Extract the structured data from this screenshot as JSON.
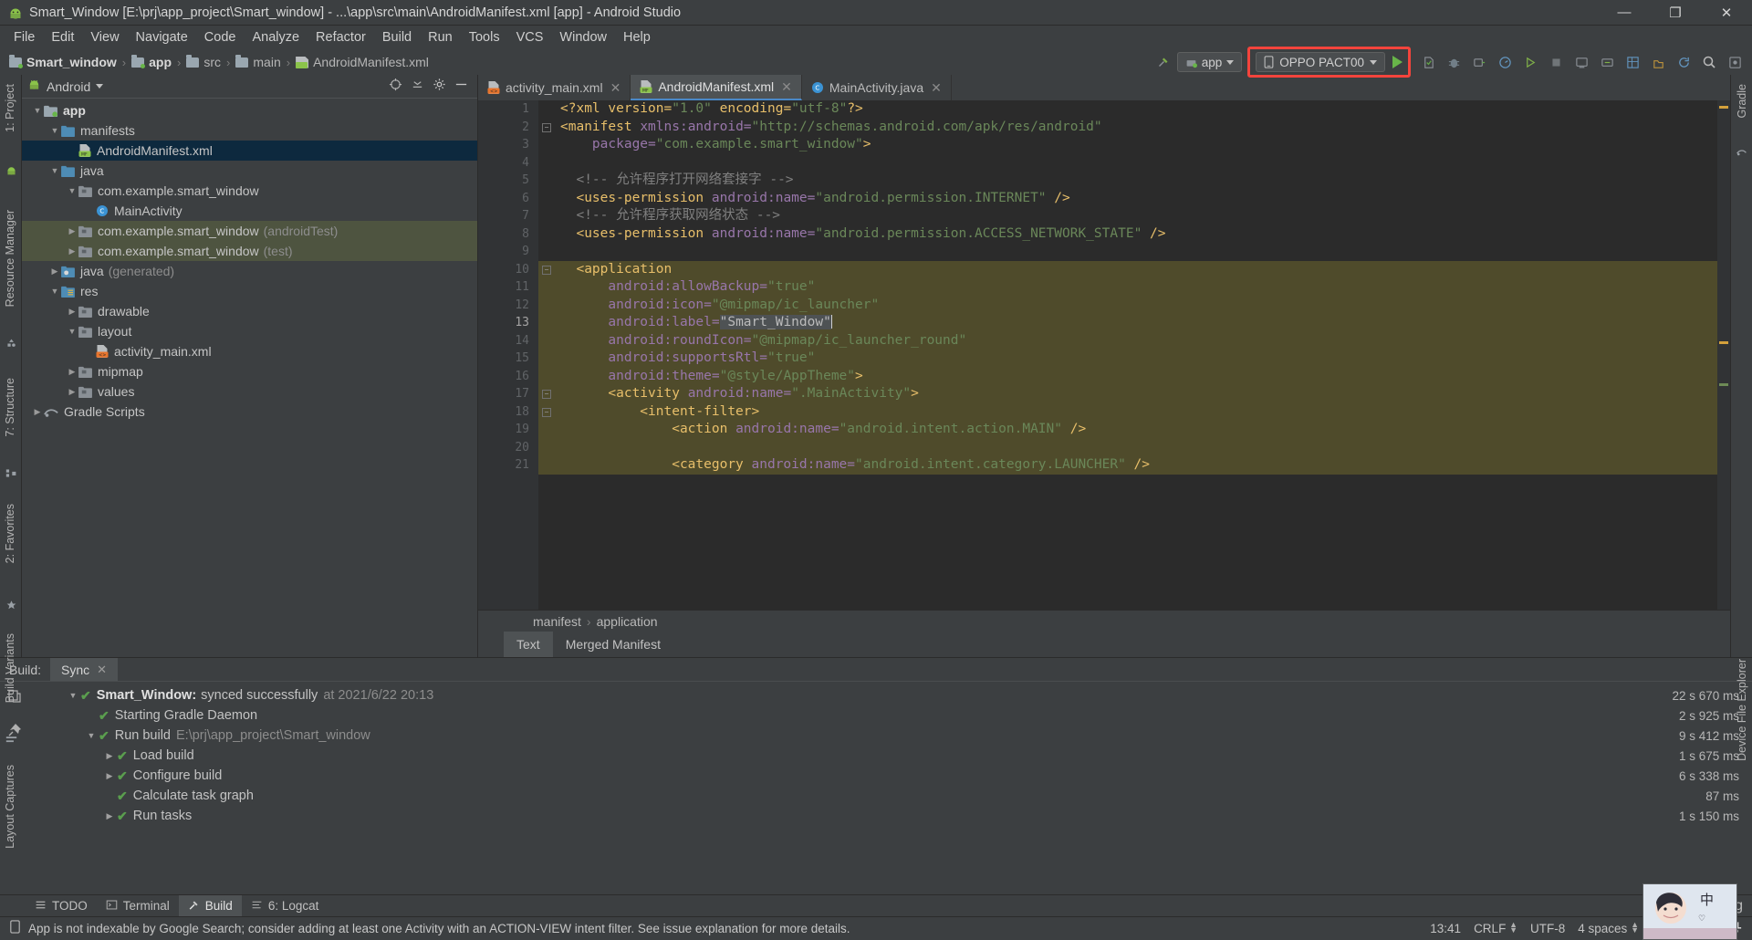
{
  "window": {
    "title": "Smart_Window [E:\\prj\\app_project\\Smart_window] - ...\\app\\src\\main\\AndroidManifest.xml [app] - Android Studio",
    "icon": "android-studio-icon",
    "minimize": "—",
    "maximize": "❐",
    "close": "✕"
  },
  "menu": {
    "items": [
      "File",
      "Edit",
      "View",
      "Navigate",
      "Code",
      "Analyze",
      "Refactor",
      "Build",
      "Run",
      "Tools",
      "VCS",
      "Window",
      "Help"
    ]
  },
  "breadcrumb": {
    "items": [
      "Smart_window",
      "app",
      "src",
      "main",
      "AndroidManifest.xml"
    ]
  },
  "toolbar": {
    "module_label": "app",
    "device_label": "OPPO PACT00",
    "run_tooltip": "Run",
    "icons": [
      "build-hammer-icon",
      "run-icon",
      "debug-icon",
      "attach-debugger-icon",
      "profiler-icon",
      "run-coverage-icon",
      "stop-icon",
      "avd-manager-icon",
      "sdk-manager-icon",
      "layout-inspector-icon",
      "device-file-explorer-icon",
      "sync-gradle-icon",
      "search-icon",
      "settings-icon"
    ]
  },
  "left_rail": {
    "items": [
      "1: Project",
      "Resource Manager",
      "7: Structure",
      "2: Favorites",
      "Build Variants",
      "Layout Captures"
    ]
  },
  "right_rail": {
    "items": [
      "Gradle",
      "Device File Explorer"
    ]
  },
  "project_panel": {
    "title": "Android",
    "tree": [
      {
        "depth": 0,
        "arrow": "down",
        "icon": "app-module-icon",
        "label": "app",
        "suffix": "",
        "bold": true,
        "state": "normal"
      },
      {
        "depth": 1,
        "arrow": "down",
        "icon": "folder-blue-icon",
        "label": "manifests",
        "suffix": "",
        "bold": false,
        "state": "normal"
      },
      {
        "depth": 2,
        "arrow": "none",
        "icon": "manifest-file-icon",
        "label": "AndroidManifest.xml",
        "suffix": "",
        "bold": false,
        "state": "selected"
      },
      {
        "depth": 1,
        "arrow": "down",
        "icon": "folder-blue-icon",
        "label": "java",
        "suffix": "",
        "bold": false,
        "state": "normal"
      },
      {
        "depth": 2,
        "arrow": "down",
        "icon": "package-icon",
        "label": "com.example.smart_window",
        "suffix": "",
        "bold": false,
        "state": "normal"
      },
      {
        "depth": 3,
        "arrow": "none",
        "icon": "java-class-icon",
        "label": "MainActivity",
        "suffix": "",
        "bold": false,
        "state": "normal"
      },
      {
        "depth": 2,
        "arrow": "right",
        "icon": "package-icon",
        "label": "com.example.smart_window",
        "suffix": "(androidTest)",
        "bold": false,
        "state": "test"
      },
      {
        "depth": 2,
        "arrow": "right",
        "icon": "package-icon",
        "label": "com.example.smart_window",
        "suffix": "(test)",
        "bold": false,
        "state": "test"
      },
      {
        "depth": 1,
        "arrow": "right",
        "icon": "folder-generated-icon",
        "label": "java",
        "suffix": "(generated)",
        "bold": false,
        "state": "normal"
      },
      {
        "depth": 1,
        "arrow": "down",
        "icon": "folder-res-icon",
        "label": "res",
        "suffix": "",
        "bold": false,
        "state": "normal"
      },
      {
        "depth": 2,
        "arrow": "right",
        "icon": "package-icon",
        "label": "drawable",
        "suffix": "",
        "bold": false,
        "state": "normal"
      },
      {
        "depth": 2,
        "arrow": "down",
        "icon": "package-icon",
        "label": "layout",
        "suffix": "",
        "bold": false,
        "state": "normal"
      },
      {
        "depth": 3,
        "arrow": "none",
        "icon": "layout-file-icon",
        "label": "activity_main.xml",
        "suffix": "",
        "bold": false,
        "state": "normal"
      },
      {
        "depth": 2,
        "arrow": "right",
        "icon": "package-icon",
        "label": "mipmap",
        "suffix": "",
        "bold": false,
        "state": "normal"
      },
      {
        "depth": 2,
        "arrow": "right",
        "icon": "package-icon",
        "label": "values",
        "suffix": "",
        "bold": false,
        "state": "normal"
      },
      {
        "depth": 0,
        "arrow": "right",
        "icon": "gradle-icon",
        "label": "Gradle Scripts",
        "suffix": "",
        "bold": false,
        "state": "normal"
      }
    ]
  },
  "editor": {
    "tabs": [
      {
        "label": "activity_main.xml",
        "icon": "layout-file-icon",
        "active": false
      },
      {
        "label": "AndroidManifest.xml",
        "icon": "manifest-file-icon",
        "active": true
      },
      {
        "label": "MainActivity.java",
        "icon": "java-class-icon",
        "active": false
      }
    ],
    "lines": [
      {
        "n": "1",
        "highlight": false,
        "fold": "",
        "spans": [
          {
            "t": "<?xml ",
            "c": "tag"
          },
          {
            "t": "version=",
            "c": "tag"
          },
          {
            "t": "\"1.0\"",
            "c": "str"
          },
          {
            "t": " encoding=",
            "c": "tag"
          },
          {
            "t": "\"utf-8\"",
            "c": "str"
          },
          {
            "t": "?>",
            "c": "tag"
          }
        ]
      },
      {
        "n": "2",
        "highlight": false,
        "fold": "minus",
        "spans": [
          {
            "t": "<manifest ",
            "c": "tag"
          },
          {
            "t": "xmlns:android=",
            "c": "ns"
          },
          {
            "t": "\"http://schemas.android.com/apk/res/android\"",
            "c": "str"
          }
        ]
      },
      {
        "n": "3",
        "highlight": false,
        "fold": "",
        "spans": [
          {
            "t": "    package=",
            "c": "attr"
          },
          {
            "t": "\"com.example.smart_window\"",
            "c": "str"
          },
          {
            "t": ">",
            "c": "tag"
          }
        ]
      },
      {
        "n": "4",
        "highlight": false,
        "fold": "",
        "spans": []
      },
      {
        "n": "5",
        "highlight": false,
        "fold": "",
        "spans": [
          {
            "t": "  <!-- 允许程序打开网络套接字 -->",
            "c": "cmt"
          }
        ]
      },
      {
        "n": "6",
        "highlight": false,
        "fold": "",
        "spans": [
          {
            "t": "  <uses-permission ",
            "c": "tag"
          },
          {
            "t": "android:name=",
            "c": "attr"
          },
          {
            "t": "\"android.permission.INTERNET\"",
            "c": "str"
          },
          {
            "t": " />",
            "c": "tag"
          }
        ]
      },
      {
        "n": "7",
        "highlight": false,
        "fold": "",
        "spans": [
          {
            "t": "  <!-- 允许程序获取网络状态 -->",
            "c": "cmt"
          }
        ]
      },
      {
        "n": "8",
        "highlight": false,
        "fold": "",
        "spans": [
          {
            "t": "  <uses-permission ",
            "c": "tag"
          },
          {
            "t": "android:name=",
            "c": "attr"
          },
          {
            "t": "\"android.permission.ACCESS_NETWORK_STATE\"",
            "c": "str"
          },
          {
            "t": " />",
            "c": "tag"
          }
        ]
      },
      {
        "n": "9",
        "highlight": false,
        "fold": "",
        "spans": []
      },
      {
        "n": "10",
        "highlight": true,
        "fold": "minus",
        "spans": [
          {
            "t": "  <application",
            "c": "tag"
          }
        ]
      },
      {
        "n": "11",
        "highlight": true,
        "fold": "",
        "spans": [
          {
            "t": "      android:allowBackup=",
            "c": "attr"
          },
          {
            "t": "\"true\"",
            "c": "str"
          }
        ]
      },
      {
        "n": "12",
        "highlight": true,
        "fold": "",
        "spans": [
          {
            "t": "      android:icon=",
            "c": "attr"
          },
          {
            "t": "\"@mipmap/ic_launcher\"",
            "c": "str"
          }
        ]
      },
      {
        "n": "13",
        "highlight": true,
        "fold": "",
        "bulb": true,
        "spans": [
          {
            "t": "      android:label=",
            "c": "attr"
          },
          {
            "t": "\"Smart_Window\"",
            "c": "selq"
          },
          {
            "t": "|",
            "c": "caret"
          }
        ]
      },
      {
        "n": "14",
        "highlight": true,
        "fold": "",
        "spans": [
          {
            "t": "      android:roundIcon=",
            "c": "attr"
          },
          {
            "t": "\"@mipmap/ic_launcher_round\"",
            "c": "str"
          }
        ]
      },
      {
        "n": "15",
        "highlight": true,
        "fold": "",
        "spans": [
          {
            "t": "      android:supportsRtl=",
            "c": "attr"
          },
          {
            "t": "\"true\"",
            "c": "str"
          }
        ]
      },
      {
        "n": "16",
        "highlight": true,
        "fold": "",
        "spans": [
          {
            "t": "      android:theme=",
            "c": "attr"
          },
          {
            "t": "\"@style/AppTheme\"",
            "c": "str"
          },
          {
            "t": ">",
            "c": "tag"
          }
        ]
      },
      {
        "n": "17",
        "highlight": true,
        "fold": "minus",
        "spans": [
          {
            "t": "      <activity ",
            "c": "tag"
          },
          {
            "t": "android:name=",
            "c": "attr"
          },
          {
            "t": "\".MainActivity\"",
            "c": "str"
          },
          {
            "t": ">",
            "c": "tag"
          }
        ]
      },
      {
        "n": "18",
        "highlight": true,
        "fold": "minus",
        "spans": [
          {
            "t": "          <intent-filter>",
            "c": "tag"
          }
        ]
      },
      {
        "n": "19",
        "highlight": true,
        "fold": "",
        "spans": [
          {
            "t": "              <action ",
            "c": "tag"
          },
          {
            "t": "android:name=",
            "c": "attr"
          },
          {
            "t": "\"android.intent.action.MAIN\"",
            "c": "str"
          },
          {
            "t": " />",
            "c": "tag"
          }
        ]
      },
      {
        "n": "20",
        "highlight": true,
        "fold": "",
        "spans": []
      },
      {
        "n": "21",
        "highlight": true,
        "fold": "",
        "spans": [
          {
            "t": "              <category ",
            "c": "tag"
          },
          {
            "t": "android:name=",
            "c": "attr"
          },
          {
            "t": "\"android.intent.category.LAUNCHER\"",
            "c": "str"
          },
          {
            "t": " />",
            "c": "tag"
          }
        ]
      }
    ],
    "breadcrumbs": [
      "manifest",
      "application"
    ],
    "design_tabs": [
      {
        "label": "Text",
        "active": true
      },
      {
        "label": "Merged Manifest",
        "active": false
      }
    ]
  },
  "build_panel": {
    "header_title": "Build:",
    "tab_label": "Sync",
    "rows": [
      {
        "depth": 0,
        "tri": "down",
        "label_bold": "Smart_Window:",
        "label": "synced successfully",
        "muted": "at 2021/6/22 20:13",
        "time": "22 s 670 ms"
      },
      {
        "depth": 1,
        "tri": "none",
        "label_bold": "",
        "label": "Starting Gradle Daemon",
        "muted": "",
        "time": "2 s 925 ms"
      },
      {
        "depth": 1,
        "tri": "down",
        "label_bold": "",
        "label": "Run build",
        "muted": "E:\\prj\\app_project\\Smart_window",
        "time": "9 s 412 ms"
      },
      {
        "depth": 2,
        "tri": "right",
        "label_bold": "",
        "label": "Load build",
        "muted": "",
        "time": "1 s 675 ms"
      },
      {
        "depth": 2,
        "tri": "right",
        "label_bold": "",
        "label": "Configure build",
        "muted": "",
        "time": "6 s 338 ms"
      },
      {
        "depth": 2,
        "tri": "none",
        "label_bold": "",
        "label": "Calculate task graph",
        "muted": "",
        "time": "87 ms"
      },
      {
        "depth": 2,
        "tri": "right",
        "label_bold": "",
        "label": "Run tasks",
        "muted": "",
        "time": "1 s 150 ms"
      }
    ]
  },
  "tool_windows": {
    "items": [
      {
        "label": "TODO",
        "icon": "todo-icon",
        "active": false
      },
      {
        "label": "Terminal",
        "icon": "terminal-icon",
        "active": false
      },
      {
        "label": "Build",
        "icon": "build-hammer-icon",
        "active": true
      },
      {
        "label": "6: Logcat",
        "icon": "logcat-icon",
        "active": false
      }
    ],
    "event_log": {
      "label": "Event Log",
      "count": "2"
    }
  },
  "status_bar": {
    "message": "App is not indexable by Google Search; consider adding at least one Activity with an ACTION-VIEW intent filter. See issue explanation for more details.",
    "time": "13:41",
    "line_separator": "CRLF",
    "encoding": "UTF-8",
    "indent": "4 spaces",
    "lock_icon": "unlocked-icon",
    "faces": [
      "smile-icon",
      "frown-icon",
      "hat-icon"
    ]
  },
  "colors": {
    "accent_blue": "#4a88c7",
    "run_green": "#68b549",
    "highlight_red": "#f4443c",
    "selection_navy": "#0d293e",
    "test_green": "#4e5440",
    "code_highlight": "#4f4b2b"
  }
}
